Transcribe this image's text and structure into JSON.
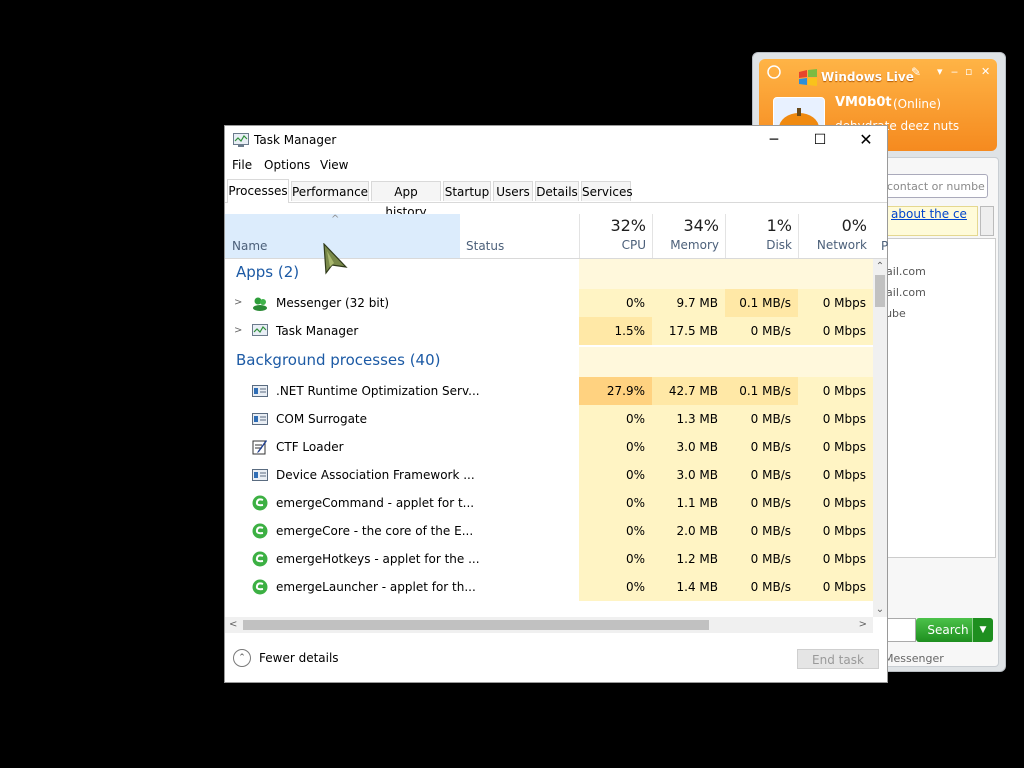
{
  "messenger": {
    "title": "Windows Live",
    "username": "VM0b0t",
    "status": "(Online)",
    "personal_message": "dehydrate deez nuts",
    "search_placeholder": "contact or numbe",
    "banner_text": "about the ce",
    "contacts": [
      "tmail.com",
      "tmail.com",
      "r cube"
    ],
    "search_button": "Search",
    "footer": "Messenger",
    "accent": "#f58a1f"
  },
  "taskmanager": {
    "title": "Task Manager",
    "menu": [
      "File",
      "Options",
      "View"
    ],
    "tabs": [
      "Processes",
      "Performance",
      "App history",
      "Startup",
      "Users",
      "Details",
      "Services"
    ],
    "active_tab": "Processes",
    "columns": {
      "name": "Name",
      "status": "Status",
      "cpu": {
        "pct": "32%",
        "label": "CPU"
      },
      "memory": {
        "pct": "34%",
        "label": "Memory"
      },
      "disk": {
        "pct": "1%",
        "label": "Disk"
      },
      "network": {
        "pct": "0%",
        "label": "Network"
      },
      "power": "P"
    },
    "groups": {
      "apps": "Apps (2)",
      "background": "Background processes (40)"
    },
    "apps": [
      {
        "name": "Messenger (32 bit)",
        "icon": "messenger-icon",
        "cpu": "0%",
        "memory": "9.7 MB",
        "disk": "0.1 MB/s",
        "network": "0 Mbps"
      },
      {
        "name": "Task Manager",
        "icon": "taskmanager-icon",
        "cpu": "1.5%",
        "memory": "17.5 MB",
        "disk": "0 MB/s",
        "network": "0 Mbps"
      }
    ],
    "background": [
      {
        "name": ".NET Runtime Optimization Serv...",
        "icon": "service-icon",
        "cpu": "27.9%",
        "memory": "42.7 MB",
        "disk": "0.1 MB/s",
        "network": "0 Mbps"
      },
      {
        "name": "COM Surrogate",
        "icon": "service-icon",
        "cpu": "0%",
        "memory": "1.3 MB",
        "disk": "0 MB/s",
        "network": "0 Mbps"
      },
      {
        "name": "CTF Loader",
        "icon": "ctf-icon",
        "cpu": "0%",
        "memory": "3.0 MB",
        "disk": "0 MB/s",
        "network": "0 Mbps"
      },
      {
        "name": "Device Association Framework ...",
        "icon": "service-icon",
        "cpu": "0%",
        "memory": "3.0 MB",
        "disk": "0 MB/s",
        "network": "0 Mbps"
      },
      {
        "name": "emergeCommand - applet for t...",
        "icon": "emerge-icon",
        "cpu": "0%",
        "memory": "1.1 MB",
        "disk": "0 MB/s",
        "network": "0 Mbps"
      },
      {
        "name": "emergeCore - the core of the E...",
        "icon": "emerge-icon",
        "cpu": "0%",
        "memory": "2.0 MB",
        "disk": "0 MB/s",
        "network": "0 Mbps"
      },
      {
        "name": "emergeHotkeys - applet for the ...",
        "icon": "emerge-icon",
        "cpu": "0%",
        "memory": "1.2 MB",
        "disk": "0 MB/s",
        "network": "0 Mbps"
      },
      {
        "name": "emergeLauncher - applet for th...",
        "icon": "emerge-icon",
        "cpu": "0%",
        "memory": "1.4 MB",
        "disk": "0 MB/s",
        "network": "0 Mbps"
      }
    ],
    "footer": {
      "fewer_details": "Fewer details",
      "end_task": "End task"
    },
    "heat_colors": {
      "low": "#fff4c4",
      "medium": "#ffe8a6",
      "high": "#ffd280",
      "group": "#fff8dc"
    }
  }
}
